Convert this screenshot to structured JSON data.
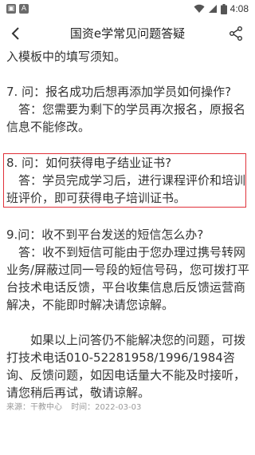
{
  "status_bar": {
    "time": "4:08",
    "left_icons": [
      "notification-icon",
      "a-icon"
    ],
    "right_icons": [
      "wifi-icon",
      "signal-icon",
      "battery-icon"
    ]
  },
  "header": {
    "title": "国资e学常见问题答疑",
    "back_icon": "chevron-left-icon",
    "share_icon": "share-icon"
  },
  "article": {
    "intro_tail": "入模板中的填写须知。",
    "q7": {
      "question": "7. 问：报名成功后想再添加学员如何操作?",
      "answer": "答：您需要为剩下的学员再次报名，原报名信息不能修改。"
    },
    "q8": {
      "question": "8. 问：如何获得电子结业证书?",
      "answer": "答：学员完成学习后，进行课程评价和培训班评价，即可获得电子培训证书。"
    },
    "q9": {
      "question": "9.问：收不到平台发送的短信怎么办?",
      "answer": "答：收不到短信可能由于您办理过携号转网业务/屏蔽过同一号段的短信号码，您可拨打平台技术电话反馈，平台收集信息后反馈运营商解决，不能即时解决请您谅解。"
    },
    "closing": "如果以上问答仍不能解决您的问题，可拨打技术电话010-52281958/1996/1984咨询、反馈问题，如因电话量大不能及时接听，请您稍后再试，敬请谅解。",
    "source_label": "来源：干教中心",
    "time_label": "时间：2022-03-03"
  },
  "colors": {
    "highlight_border": "#e0323a",
    "text": "#333333",
    "meta_text": "#999999"
  }
}
